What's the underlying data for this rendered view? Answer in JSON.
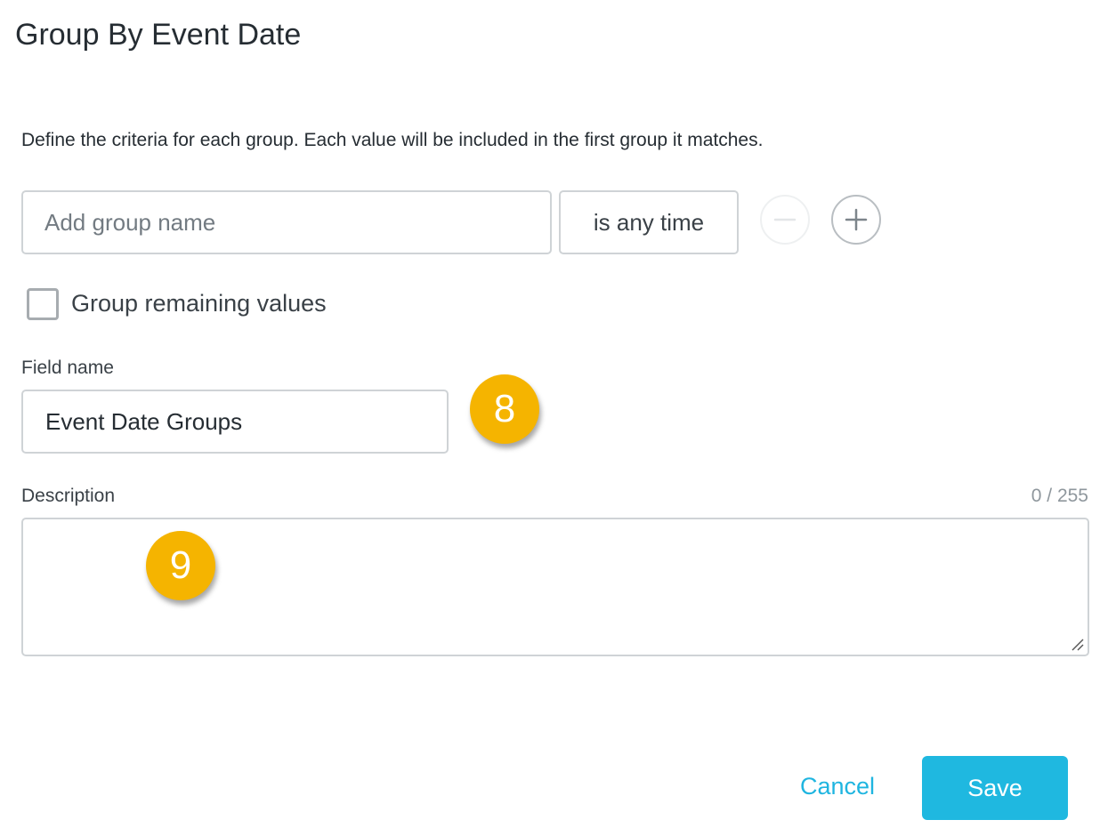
{
  "dialog": {
    "title": "Group By Event Date",
    "instructions": "Define the criteria for each group. Each value will be included in the first group it matches."
  },
  "group_row": {
    "name_placeholder": "Add group name",
    "name_value": "",
    "condition_label": "is any time",
    "remove_icon": "minus-circle-icon",
    "add_icon": "plus-circle-icon"
  },
  "remaining": {
    "checkbox_label": "Group remaining values",
    "checked": false
  },
  "field_name": {
    "label": "Field name",
    "value": "Event Date Groups"
  },
  "description": {
    "label": "Description",
    "value": "",
    "char_count": "0 / 255"
  },
  "callouts": {
    "badge_a": "8",
    "badge_b": "9",
    "color": "#f5b400"
  },
  "actions": {
    "cancel_label": "Cancel",
    "save_label": "Save"
  },
  "colors": {
    "accent": "#1fb8e0",
    "text": "#262d33",
    "border": "#cfd3d6"
  }
}
